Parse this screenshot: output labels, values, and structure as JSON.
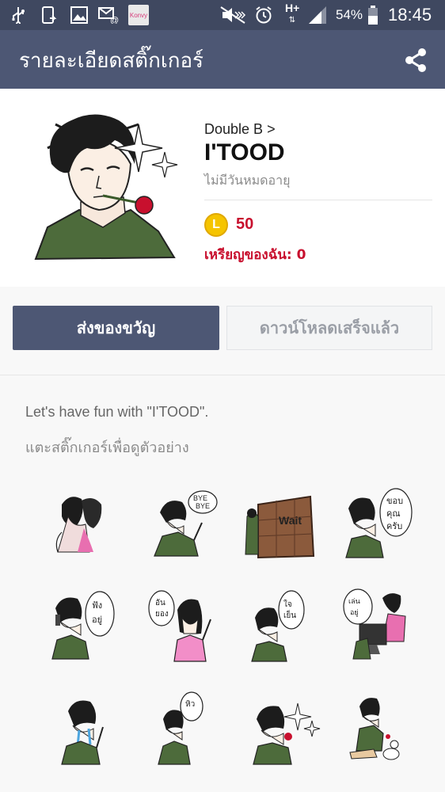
{
  "status_bar": {
    "battery_percent": "54%",
    "time": "18:45",
    "network": "H+",
    "icons": [
      "usb-icon",
      "sync-icon",
      "gallery-icon",
      "email-icon",
      "konvy-app-icon",
      "mute-icon",
      "alarm-icon",
      "signal-icon",
      "battery-icon"
    ],
    "konvy_label": "Konvy"
  },
  "app_bar": {
    "title": "รายละเอียดสติ๊กเกอร์",
    "share_icon": "share-icon"
  },
  "sticker_pack": {
    "author": "Double B",
    "author_chevron": ">",
    "title": "I'TOOD",
    "validity": "ไม่มีวันหมดอายุ",
    "coin_label": "L",
    "price": "50",
    "my_coins_label": "เหรียญของฉัน:",
    "my_coins_value": "0"
  },
  "buttons": {
    "gift": "ส่งของขวัญ",
    "downloaded": "ดาวน์โหลดเสร็จแล้ว"
  },
  "description": "Let's have fun with \"I'TOOD\".",
  "preview_hint": "แตะสติ๊กเกอร์เพื่อดูตัวอย่าง",
  "stickers": [
    {
      "name": "sticker-couple-kiss",
      "text": ""
    },
    {
      "name": "sticker-bye-bye",
      "text": "BYE BYE"
    },
    {
      "name": "sticker-wait-wall",
      "text": "Wait"
    },
    {
      "name": "sticker-thank-you",
      "text": "ขอบคุณครับ"
    },
    {
      "name": "sticker-phone-call",
      "text": "ฟังอยู่"
    },
    {
      "name": "sticker-girl-wave",
      "text": "อันยอง"
    },
    {
      "name": "sticker-calm-down",
      "text": "ใจเย็น"
    },
    {
      "name": "sticker-computer-game",
      "text": "เล่นอยู่"
    },
    {
      "name": "sticker-crying",
      "text": ""
    },
    {
      "name": "sticker-hungry",
      "text": "หิว"
    },
    {
      "name": "sticker-rose-sparkle",
      "text": ""
    },
    {
      "name": "sticker-sitting-dog",
      "text": ""
    }
  ]
}
